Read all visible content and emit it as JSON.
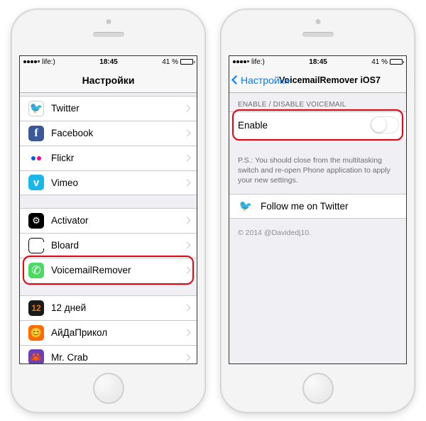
{
  "status": {
    "carrier": "life:)",
    "time": "18:45",
    "battery_pct": "41 %"
  },
  "left": {
    "nav_title": "Настройки",
    "groups": [
      {
        "items": [
          {
            "key": "twitter",
            "label": "Twitter"
          },
          {
            "key": "facebook",
            "label": "Facebook"
          },
          {
            "key": "flickr",
            "label": "Flickr"
          },
          {
            "key": "vimeo",
            "label": "Vimeo"
          }
        ]
      },
      {
        "items": [
          {
            "key": "activator",
            "label": "Activator"
          },
          {
            "key": "bloard",
            "label": "Bloard"
          },
          {
            "key": "vmr",
            "label": "VoicemailRemover",
            "highlight": true
          }
        ]
      },
      {
        "items": [
          {
            "key": "12days",
            "label": "12 дней"
          },
          {
            "key": "aida",
            "label": "АйДаПрикол"
          },
          {
            "key": "crab",
            "label": "Mr. Crab"
          }
        ]
      }
    ]
  },
  "right": {
    "back_label": "Настройки",
    "nav_title": "VoicemailRemover iOS7",
    "section_header": "ENABLE / DISABLE VOICEMAIL",
    "enable_label": "Enable",
    "enable_on": false,
    "ps_note": "P.S.: You should close from the multitasking switch and re-open Phone application to apply your new settings.",
    "follow_label": "Follow me on Twitter",
    "copyright": "© 2014 @Davidedj10."
  }
}
